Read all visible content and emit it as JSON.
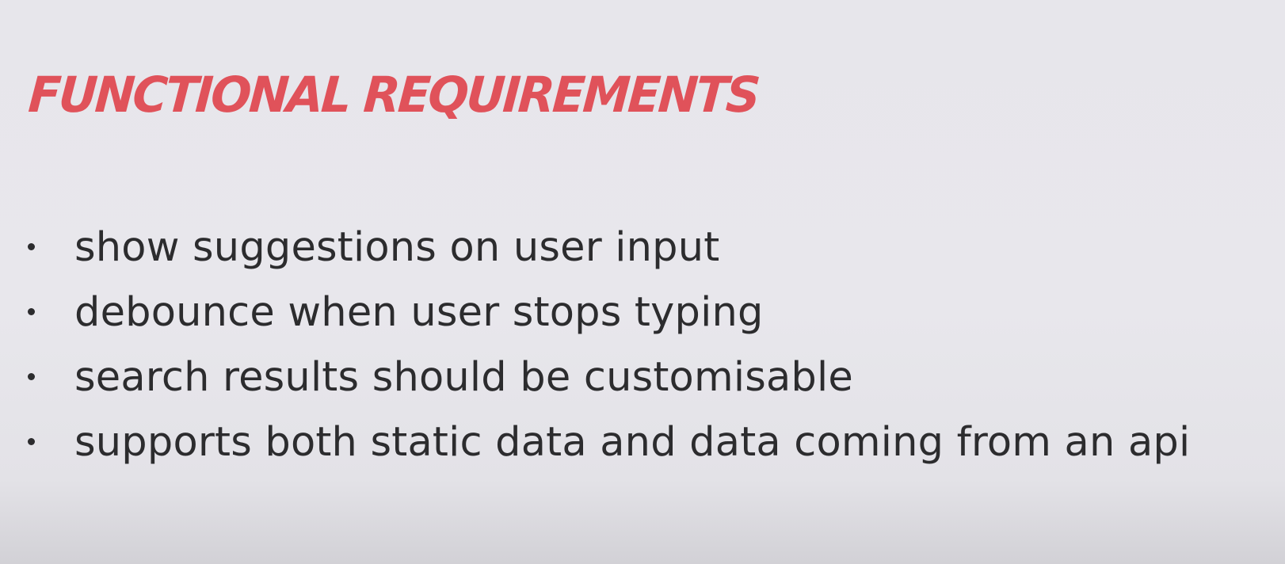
{
  "slide": {
    "title": "Functional Requirements",
    "bullets": [
      "show suggestions on user input",
      "debounce when user stops typing",
      "search results should be customisable",
      "supports both static data and data coming from an api"
    ]
  },
  "colors": {
    "title": "#e0525a",
    "text": "#2c2c2e",
    "background": "#e7e6eb"
  }
}
